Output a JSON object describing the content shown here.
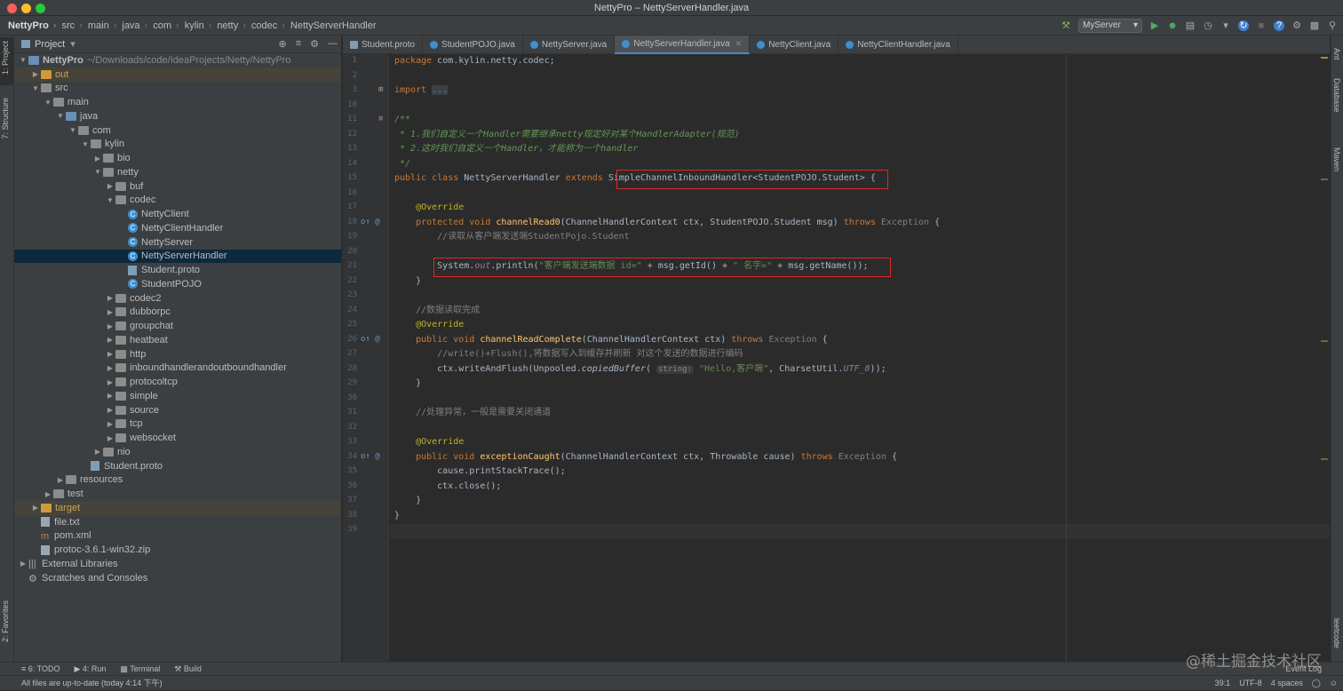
{
  "window": {
    "title": "NettyPro – NettyServerHandler.java"
  },
  "breadcrumb": [
    "NettyPro",
    "src",
    "main",
    "java",
    "com",
    "kylin",
    "netty",
    "codec",
    "NettyServerHandler"
  ],
  "run_config": "MyServer",
  "left_tool_tabs": [
    "1: Project",
    "7: Structure",
    "2: Favorites"
  ],
  "right_tool_tabs": [
    "Ant",
    "Database",
    "Maven",
    "leetcode"
  ],
  "project_panel": {
    "title": "Project",
    "items": [
      {
        "label": "NettyPro",
        "extra": "~/Downloads/code/IdeaProjects/Netty/NettyPro",
        "depth": 0,
        "arrow": "down",
        "icon": "folder-blue",
        "bold": true
      },
      {
        "label": "out",
        "depth": 1,
        "arrow": "right",
        "icon": "folder-orange",
        "style": "orange"
      },
      {
        "label": "src",
        "depth": 1,
        "arrow": "down",
        "icon": "folder"
      },
      {
        "label": "main",
        "depth": 2,
        "arrow": "down",
        "icon": "folder"
      },
      {
        "label": "java",
        "depth": 3,
        "arrow": "down",
        "icon": "folder-blue"
      },
      {
        "label": "com",
        "depth": 4,
        "arrow": "down",
        "icon": "folder"
      },
      {
        "label": "kylin",
        "depth": 5,
        "arrow": "down",
        "icon": "folder"
      },
      {
        "label": "bio",
        "depth": 6,
        "arrow": "right",
        "icon": "folder"
      },
      {
        "label": "netty",
        "depth": 6,
        "arrow": "down",
        "icon": "folder"
      },
      {
        "label": "buf",
        "depth": 7,
        "arrow": "right",
        "icon": "folder"
      },
      {
        "label": "codec",
        "depth": 7,
        "arrow": "down",
        "icon": "folder"
      },
      {
        "label": "NettyClient",
        "depth": 8,
        "icon": "class"
      },
      {
        "label": "NettyClientHandler",
        "depth": 8,
        "icon": "class"
      },
      {
        "label": "NettyServer",
        "depth": 8,
        "icon": "class"
      },
      {
        "label": "NettyServerHandler",
        "depth": 8,
        "icon": "class",
        "selected": true
      },
      {
        "label": "Student.proto",
        "depth": 8,
        "icon": "proto"
      },
      {
        "label": "StudentPOJO",
        "depth": 8,
        "icon": "class"
      },
      {
        "label": "codec2",
        "depth": 7,
        "arrow": "right",
        "icon": "folder"
      },
      {
        "label": "dubborpc",
        "depth": 7,
        "arrow": "right",
        "icon": "folder"
      },
      {
        "label": "groupchat",
        "depth": 7,
        "arrow": "right",
        "icon": "folder"
      },
      {
        "label": "heatbeat",
        "depth": 7,
        "arrow": "right",
        "icon": "folder"
      },
      {
        "label": "http",
        "depth": 7,
        "arrow": "right",
        "icon": "folder"
      },
      {
        "label": "inboundhandlerandoutboundhandler",
        "depth": 7,
        "arrow": "right",
        "icon": "folder"
      },
      {
        "label": "protocoltcp",
        "depth": 7,
        "arrow": "right",
        "icon": "folder"
      },
      {
        "label": "simple",
        "depth": 7,
        "arrow": "right",
        "icon": "folder"
      },
      {
        "label": "source",
        "depth": 7,
        "arrow": "right",
        "icon": "folder"
      },
      {
        "label": "tcp",
        "depth": 7,
        "arrow": "right",
        "icon": "folder"
      },
      {
        "label": "websocket",
        "depth": 7,
        "arrow": "right",
        "icon": "folder"
      },
      {
        "label": "nio",
        "depth": 6,
        "arrow": "right",
        "icon": "folder"
      },
      {
        "label": "Student.proto",
        "depth": 5,
        "icon": "proto"
      },
      {
        "label": "resources",
        "depth": 3,
        "arrow": "right",
        "icon": "folder"
      },
      {
        "label": "test",
        "depth": 2,
        "arrow": "right",
        "icon": "folder"
      },
      {
        "label": "target",
        "depth": 1,
        "arrow": "right",
        "icon": "folder-orange",
        "style": "orange"
      },
      {
        "label": "file.txt",
        "depth": 1,
        "icon": "file"
      },
      {
        "label": "pom.xml",
        "depth": 1,
        "icon": "maven"
      },
      {
        "label": "protoc-3.6.1-win32.zip",
        "depth": 1,
        "icon": "file"
      },
      {
        "label": "External Libraries",
        "depth": 0,
        "arrow": "right",
        "icon": "lib"
      },
      {
        "label": "Scratches and Consoles",
        "depth": 0,
        "icon": "scratch"
      }
    ]
  },
  "tabs": [
    {
      "label": "Student.proto",
      "icon": "proto"
    },
    {
      "label": "StudentPOJO.java",
      "icon": "class"
    },
    {
      "label": "NettyServer.java",
      "icon": "class"
    },
    {
      "label": "NettyServerHandler.java",
      "icon": "class",
      "active": true
    },
    {
      "label": "NettyClient.java",
      "icon": "class"
    },
    {
      "label": "NettyClientHandler.java",
      "icon": "class"
    }
  ],
  "editor": {
    "line_numbers": [
      "1",
      "2",
      "3",
      "10",
      "11",
      "12",
      "13",
      "14",
      "15",
      "16",
      "17",
      "18",
      "19",
      "20",
      "21",
      "22",
      "23",
      "24",
      "25",
      "26",
      "27",
      "28",
      "29",
      "30",
      "31",
      "32",
      "33",
      "34",
      "35",
      "36",
      "37",
      "38",
      "39"
    ],
    "lines": [
      [
        {
          "t": "package ",
          "c": "kw"
        },
        {
          "t": "com.kylin.netty.codec;",
          "c": ""
        }
      ],
      [],
      [
        {
          "t": "import ",
          "c": "kw"
        },
        {
          "t": "...",
          "c": "fold"
        }
      ],
      [],
      [
        {
          "t": "/**",
          "c": "doc"
        }
      ],
      [
        {
          "t": " * 1.我们自定义一个Handler需要继承netty规定好对某个HandlerAdapter(规范)",
          "c": "doc"
        }
      ],
      [
        {
          "t": " * 2.这时我们自定义一个Handler，才能称为一个handler",
          "c": "doc"
        }
      ],
      [
        {
          "t": " */",
          "c": "doc"
        }
      ],
      [
        {
          "t": "public class ",
          "c": "kw"
        },
        {
          "t": "NettyServerHandler ",
          "c": ""
        },
        {
          "t": "extends ",
          "c": "kw"
        },
        {
          "t": "SimpleChannelInboundHandler<StudentPOJO.Student>",
          "c": ""
        },
        {
          "t": " {",
          "c": ""
        }
      ],
      [],
      [
        {
          "t": "    @Override",
          "c": "ann"
        }
      ],
      [
        {
          "t": "    protected void ",
          "c": "kw"
        },
        {
          "t": "channelRead0",
          "c": "fn"
        },
        {
          "t": "(ChannelHandlerContext ctx, StudentPOJO.Student msg) ",
          "c": ""
        },
        {
          "t": "throws ",
          "c": "kw"
        },
        {
          "t": "Exception",
          "c": "excl"
        },
        {
          "t": " {",
          "c": ""
        }
      ],
      [
        {
          "t": "        //读取从客户端发送端StudentPojo.Student",
          "c": "cm"
        }
      ],
      [],
      [
        {
          "t": "        System.",
          "c": ""
        },
        {
          "t": "out",
          "c": "st"
        },
        {
          "t": ".println(",
          "c": ""
        },
        {
          "t": "\"客户端发送端数据 id=\"",
          "c": "str"
        },
        {
          "t": " + msg.getId() + ",
          "c": ""
        },
        {
          "t": "\" 名字=\"",
          "c": "str"
        },
        {
          "t": " + msg.getName());",
          "c": ""
        }
      ],
      [
        {
          "t": "    }",
          "c": ""
        }
      ],
      [],
      [
        {
          "t": "    //数据读取完成",
          "c": "cm"
        }
      ],
      [
        {
          "t": "    @Override",
          "c": "ann"
        }
      ],
      [
        {
          "t": "    public void ",
          "c": "kw"
        },
        {
          "t": "channelReadComplete",
          "c": "fn"
        },
        {
          "t": "(ChannelHandlerContext ctx) ",
          "c": ""
        },
        {
          "t": "throws ",
          "c": "kw"
        },
        {
          "t": "Exception",
          "c": "excl"
        },
        {
          "t": " {",
          "c": ""
        }
      ],
      [
        {
          "t": "        //write()+Flush(),将数据写入到缓存并刷新 对这个发送的数据进行编码",
          "c": "cm"
        }
      ],
      [
        {
          "t": "        ctx.writeAndFlush(Unpooled.",
          "c": ""
        },
        {
          "t": "copiedBuffer",
          "c": "italic"
        },
        {
          "t": "( ",
          "c": ""
        },
        {
          "t": "string:",
          "c": "hint"
        },
        {
          "t": " \"Hello,客户端\"",
          "c": "str"
        },
        {
          "t": ", CharsetUtil.",
          "c": ""
        },
        {
          "t": "UTF_8",
          "c": "st"
        },
        {
          "t": "));",
          "c": ""
        }
      ],
      [
        {
          "t": "    }",
          "c": ""
        }
      ],
      [],
      [
        {
          "t": "    //处理异常，一般是需要关闭通道",
          "c": "cm"
        }
      ],
      [],
      [
        {
          "t": "    @Override",
          "c": "ann"
        }
      ],
      [
        {
          "t": "    public void ",
          "c": "kw"
        },
        {
          "t": "exceptionCaught",
          "c": "fn"
        },
        {
          "t": "(ChannelHandlerContext ctx, Throwable cause) ",
          "c": ""
        },
        {
          "t": "throws ",
          "c": "kw"
        },
        {
          "t": "Exception",
          "c": "excl"
        },
        {
          "t": " {",
          "c": ""
        }
      ],
      [
        {
          "t": "        cause.printStackTrace();",
          "c": ""
        }
      ],
      [
        {
          "t": "        ctx.close();",
          "c": ""
        }
      ],
      [
        {
          "t": "    }",
          "c": ""
        }
      ],
      [
        {
          "t": "}",
          "c": ""
        }
      ],
      []
    ]
  },
  "bottom_tabs": [
    "6: TODO",
    "4: Run",
    "Terminal",
    "Build"
  ],
  "status": {
    "message": "All files are up-to-date (today 4:14 下午)",
    "position": "39:1",
    "encoding": "UTF-8",
    "indent": "4 spaces",
    "event_log": "Event Log"
  },
  "watermark": "@稀土掘金技术社区",
  "colors": {
    "highlight_box": "#e0262a",
    "selection": "#0d293e",
    "accent": "#4a88c7"
  }
}
